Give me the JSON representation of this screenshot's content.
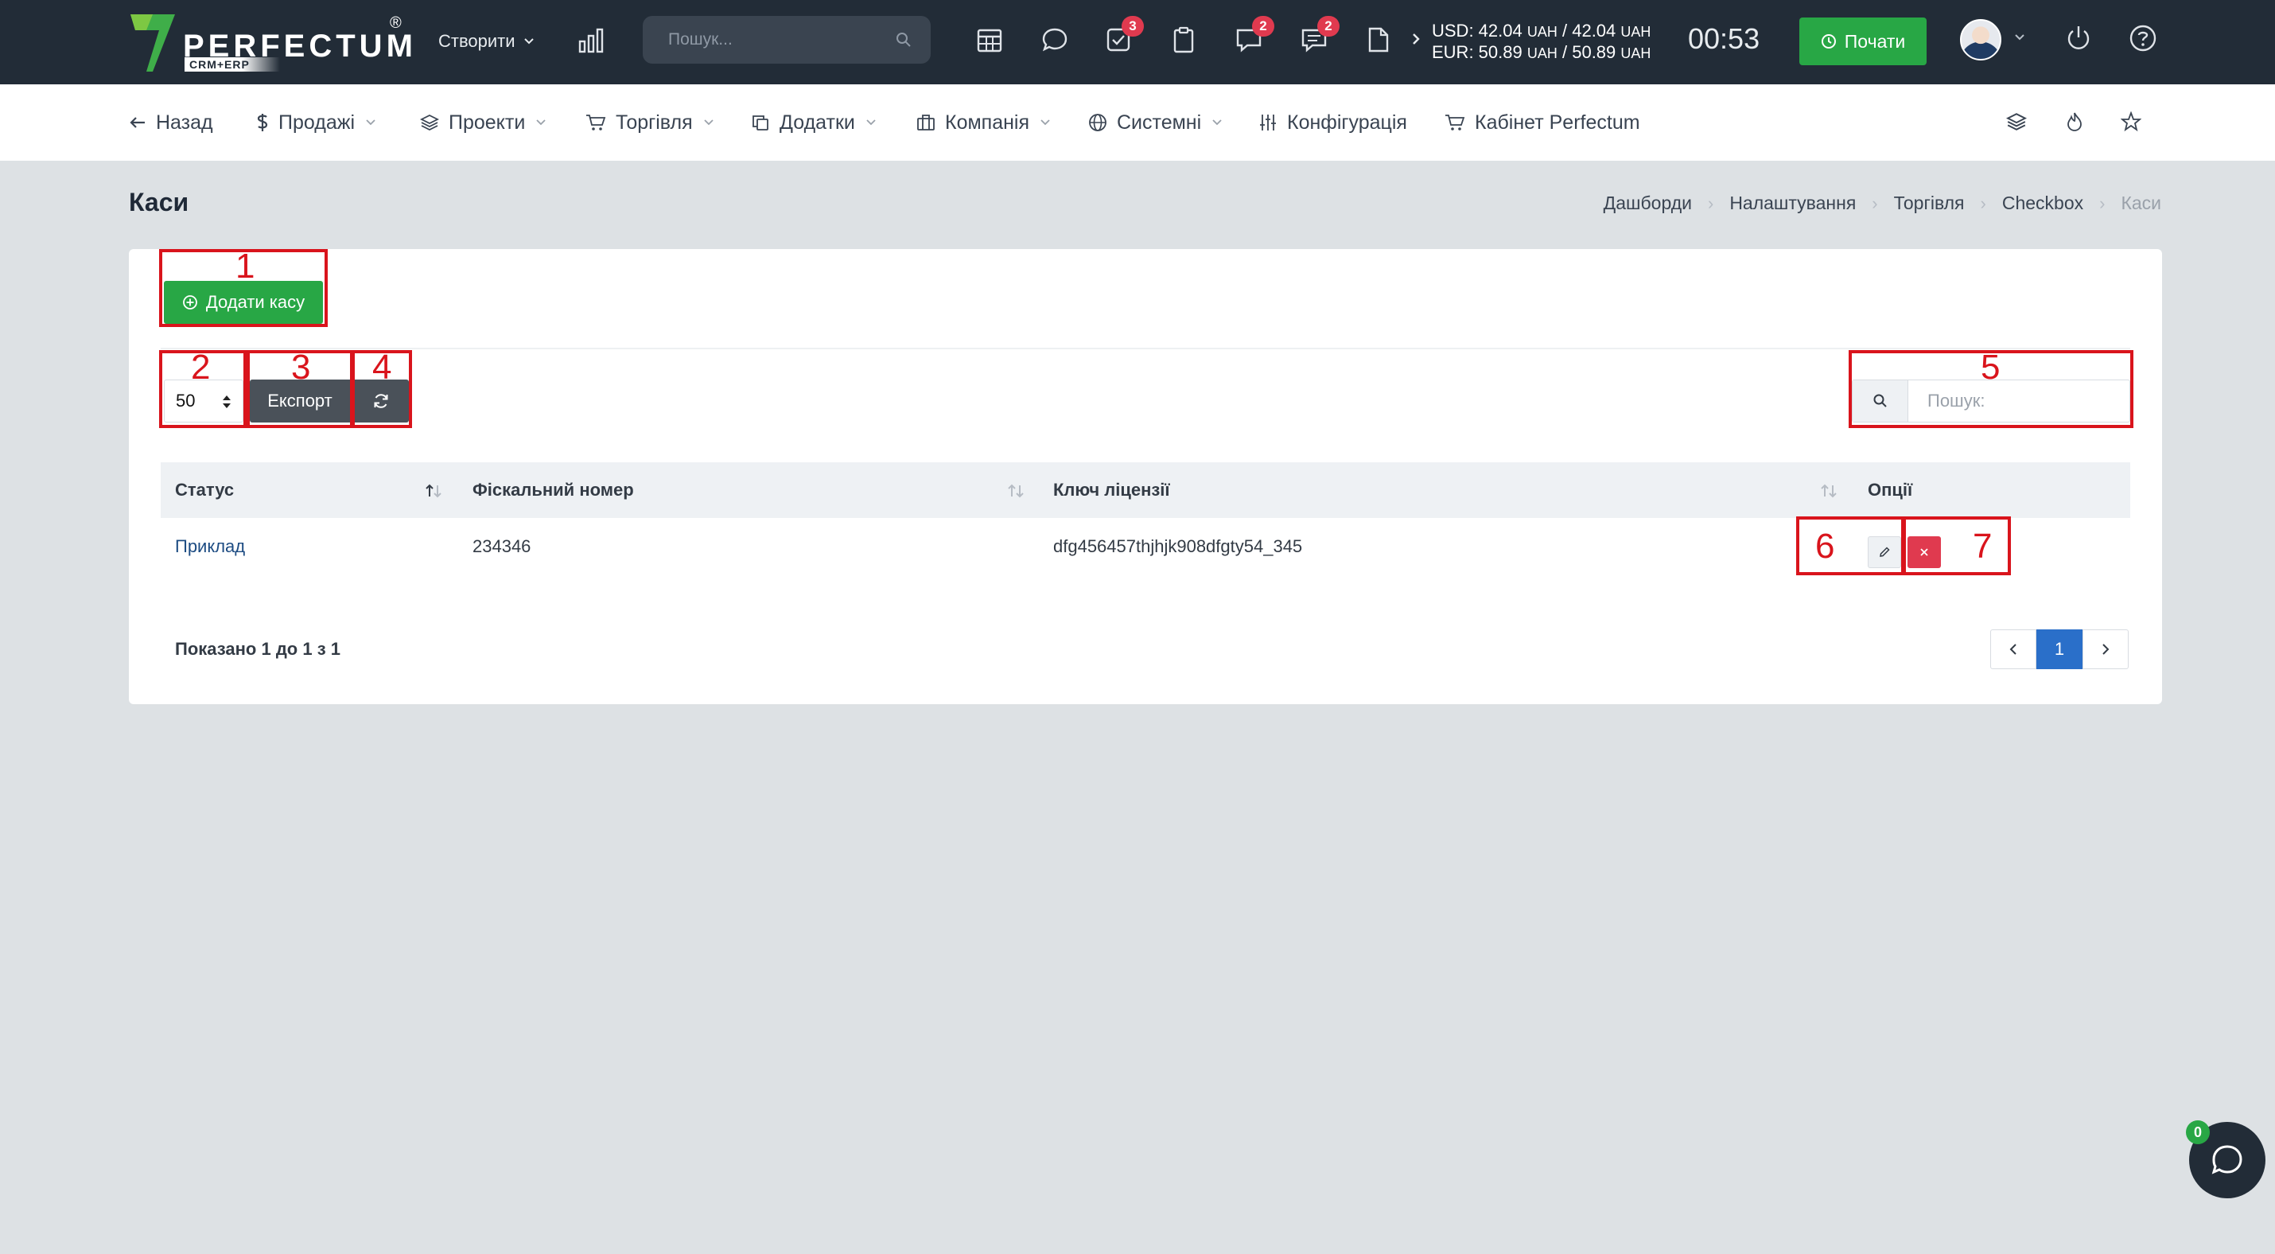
{
  "app": {
    "brand": "PERFECTUM",
    "brand_reg": "®",
    "brand_sub": "CRM+ERP"
  },
  "topbar": {
    "create_label": "Створити",
    "search_placeholder": "Пошук...",
    "badges": {
      "tasks": "3",
      "messages": "2",
      "comments": "2"
    },
    "rates": {
      "usd_prefix": "USD: 42.04",
      "usd_mid": "/ 42.04",
      "eur_prefix": "EUR: 50.89",
      "eur_mid": "/ 50.89",
      "currency": "UAH"
    },
    "timer": "00:53",
    "start_label": "Почати"
  },
  "nav": {
    "back": "Назад",
    "sales": "Продажі",
    "projects": "Проекти",
    "trade": "Торгівля",
    "addons": "Додатки",
    "company": "Компанія",
    "system": "Системні",
    "config": "Конфігурація",
    "cabinet": "Кабінет Perfectum"
  },
  "page": {
    "title": "Каси",
    "breadcrumb": [
      "Дашборди",
      "Налаштування",
      "Торгівля",
      "Checkbox",
      "Каси"
    ]
  },
  "toolbar": {
    "add_label": "Додати касу",
    "page_size": "50",
    "export_label": "Експорт",
    "search_placeholder": "Пошук:"
  },
  "table": {
    "headers": [
      "Статус",
      "Фіскальний номер",
      "Ключ ліцензії",
      "Опції"
    ],
    "rows": [
      {
        "status": "Приклад",
        "fiscal": "234346",
        "license": "dfg456457thjhjk908dfgty54_345"
      }
    ],
    "shown": "Показано 1 до 1 з 1",
    "current_page": "1"
  },
  "annotations": [
    "1",
    "2",
    "3",
    "4",
    "5",
    "6",
    "7"
  ],
  "chat": {
    "badge": "0"
  },
  "colors": {
    "topbar": "#222c37",
    "accent_green": "#28a745",
    "danger": "#e03a4f",
    "annotation_red": "#d9141c",
    "primary_blue": "#2a6fc9"
  }
}
